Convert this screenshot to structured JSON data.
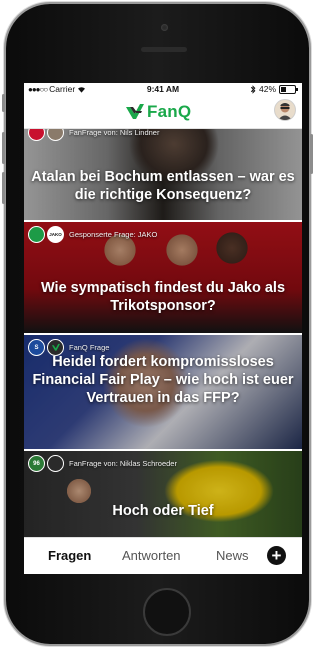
{
  "status_bar": {
    "carrier": "Carrier",
    "time": "9:41 AM",
    "battery": "42%",
    "battery_level": 0.42
  },
  "header": {
    "brand": "FanQ",
    "brand_color": "#1aa84a"
  },
  "feed": [
    {
      "meta": "FanFrage von: Nils Lindner",
      "title": "Atalan bei Bochum entlassen – war es die richtige Konsequenz?"
    },
    {
      "meta": "Gesponserte Frage: JAKO",
      "badge": "JAKO",
      "title": "Wie sympatisch findest du Jako als Trikotsponsor?"
    },
    {
      "meta": "FanQ Frage",
      "title": "Heidel fordert kompromissloses Financial Fair Play – wie hoch ist euer Vertrauen in das FFP?"
    },
    {
      "meta": "FanFrage von: Niklas Schroeder",
      "title": "Hoch oder Tief"
    }
  ],
  "tabs": [
    {
      "label": "Fragen",
      "active": true
    },
    {
      "label": "Antworten",
      "active": false
    },
    {
      "label": "News",
      "active": false
    }
  ]
}
